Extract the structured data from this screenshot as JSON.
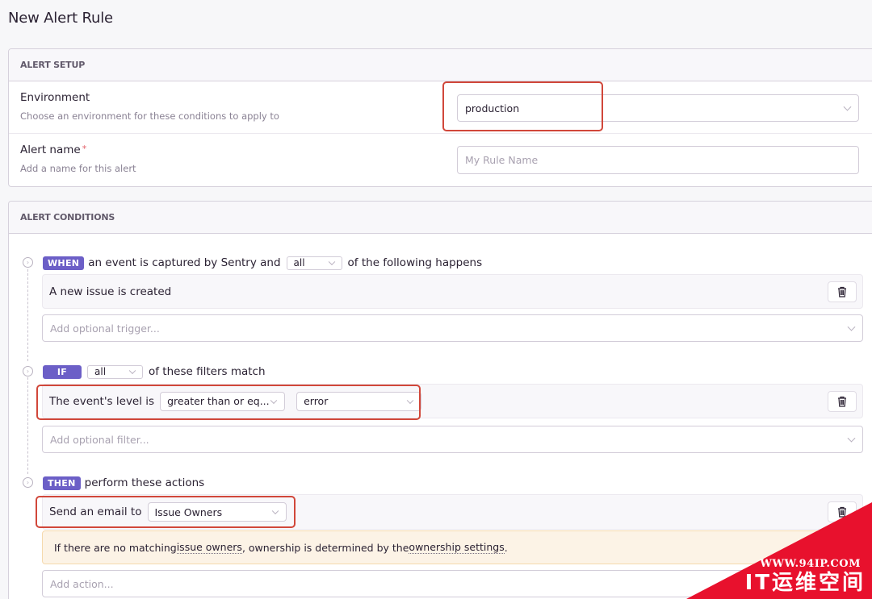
{
  "page": {
    "title": "New Alert Rule"
  },
  "alert_setup": {
    "header": "ALERT SETUP",
    "environment": {
      "label": "Environment",
      "help": "Choose an environment for these conditions to apply to",
      "value": "production"
    },
    "alert_name": {
      "label": "Alert name",
      "required_mark": "*",
      "help": "Add a name for this alert",
      "placeholder": "My Rule Name",
      "value": ""
    }
  },
  "alert_conditions": {
    "header": "ALERT CONDITIONS",
    "when": {
      "badge": "WHEN",
      "text_before": "an event is captured by Sentry and",
      "match_value": "all",
      "text_after": "of the following happens",
      "triggers": [
        {
          "text": "A new issue is created"
        }
      ],
      "add_placeholder": "Add optional trigger..."
    },
    "if": {
      "badge": "IF",
      "match_value": "all",
      "text_after": "of these filters match",
      "filters": [
        {
          "text": "The event's level is",
          "operator": "greater than or eq...",
          "level": "error"
        }
      ],
      "add_placeholder": "Add optional filter..."
    },
    "then": {
      "badge": "THEN",
      "text_after": "perform these actions",
      "actions": [
        {
          "text": "Send an email to",
          "target": "Issue Owners"
        }
      ],
      "notice": {
        "part1": "If there are no matching ",
        "link1": "issue owners",
        "part2": ", ownership is determined by the ",
        "link2": "ownership settings",
        "part3": "."
      },
      "add_placeholder": "Add action..."
    }
  },
  "watermark": {
    "url": "WWW.94IP.COM",
    "brand": "IT运维空间"
  },
  "colors": {
    "accent": "#6c5fc7",
    "highlight": "#d1473a",
    "warning_bg": "#fcf3e6",
    "watermark": "#e8112d"
  }
}
